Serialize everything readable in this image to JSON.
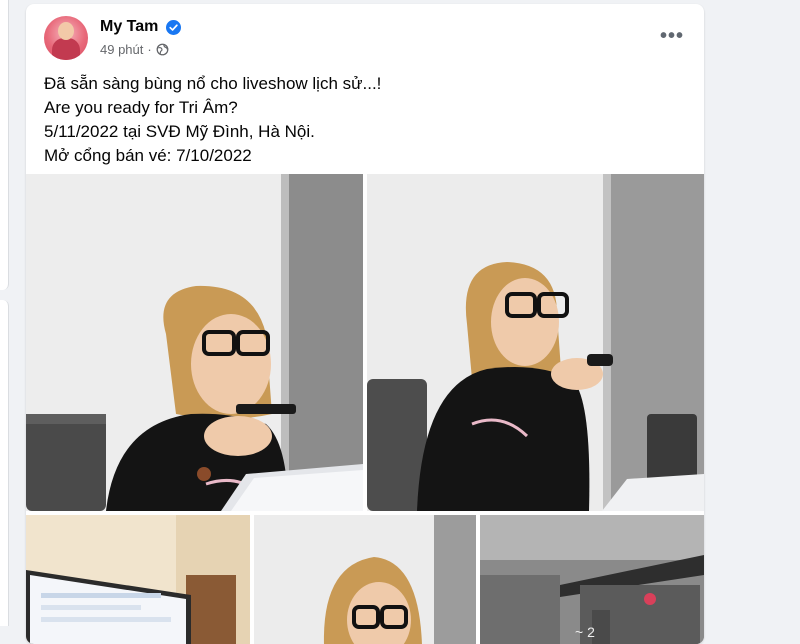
{
  "post": {
    "author": "My Tam",
    "time": "49 phút",
    "separator": "·",
    "caption_lines": [
      "Đã sẵn sàng bùng nổ cho liveshow lịch sử...!",
      "Are you ready for Tri Âm?",
      "5/11/2022 tại SVĐ Mỹ Đình, Hà Nội.",
      "Mở cổng bán vé: 7/10/2022"
    ],
    "more_label": "•••"
  },
  "colors": {
    "brand": "#1877f2",
    "card": "#ffffff",
    "page_background": "#f0f2f5",
    "secondary_text": "#65676b"
  },
  "icons": {
    "verified": "verified-badge-icon",
    "privacy": "globe-icon",
    "more": "more-options-icon"
  },
  "photos": {
    "count": 5
  }
}
